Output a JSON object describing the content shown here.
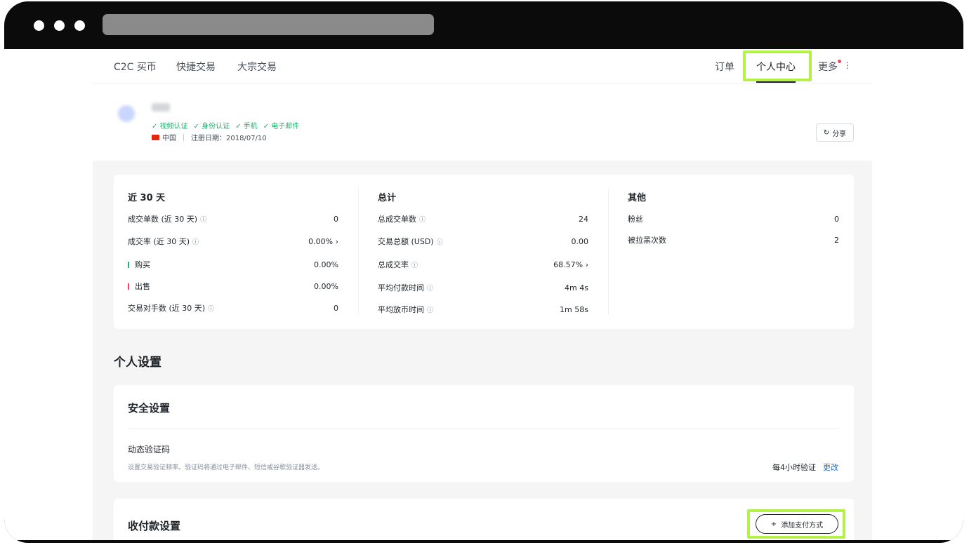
{
  "nav": {
    "left": [
      "C2C 买币",
      "快捷交易",
      "大宗交易"
    ],
    "orders": "订单",
    "center": "个人中心",
    "more": "更多"
  },
  "profile": {
    "badges": [
      "✓ 视频认证",
      "✓ 身份认证",
      "✓ 手机",
      "✓ 电子邮件"
    ],
    "country": "中国",
    "register_date": "注册日期：2018/07/10",
    "share_label": "分享"
  },
  "stats": {
    "recent": {
      "title": "近 30 天",
      "rows": [
        {
          "label": "成交单数 (近 30 天)",
          "value": "0"
        },
        {
          "label": "成交率 (近 30 天)",
          "value": "0.00% ›"
        },
        {
          "label": "购买",
          "value": "0.00%"
        },
        {
          "label": "出售",
          "value": "0.00%"
        },
        {
          "label": "交易对手数 (近 30 天)",
          "value": "0"
        }
      ]
    },
    "total": {
      "title": "总计",
      "rows": [
        {
          "label": "总成交单数",
          "value": "24"
        },
        {
          "label": "交易总额 (USD)",
          "value": "0.00"
        },
        {
          "label": "总成交率",
          "value": "68.57% ›"
        },
        {
          "label": "平均付款时间",
          "value": "4m 4s"
        },
        {
          "label": "平均放币时间",
          "value": "1m 58s"
        }
      ]
    },
    "other": {
      "title": "其他",
      "rows": [
        {
          "label": "粉丝",
          "value": "0"
        },
        {
          "label": "被拉黑次数",
          "value": "2"
        }
      ]
    }
  },
  "settings": {
    "title": "个人设置",
    "security": {
      "title": "安全设置",
      "twofa_title": "动态验证码",
      "twofa_desc": "设置交易验证频率。验证码将通过电子邮件、短信或谷歌验证器发送。",
      "frequency": "每4小时验证",
      "change": "更改"
    },
    "payment": {
      "title": "收付款设置",
      "add_label": "添加支付方式"
    }
  },
  "icons": {
    "info": "ⓘ",
    "share": "↻",
    "plus": "+"
  }
}
